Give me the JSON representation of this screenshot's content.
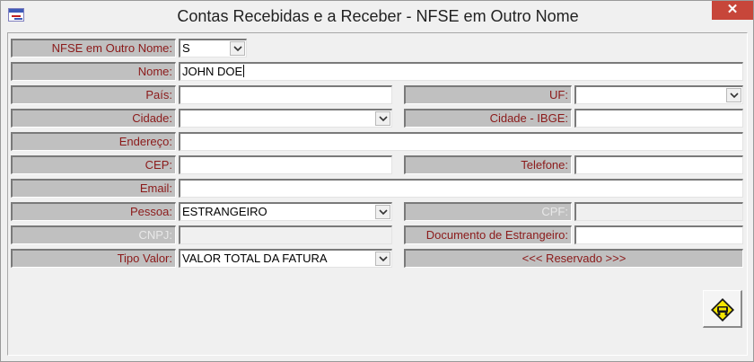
{
  "window": {
    "title": "Contas Recebidas e a Receber - NFSE em Outro Nome",
    "close_glyph": "✕",
    "icon": "form-icon"
  },
  "colors": {
    "label_text": "#8b1a1a",
    "label_bg": "#c0c0c0",
    "close_bg": "#c7463a",
    "sign_yellow": "#f5e600"
  },
  "form": {
    "nfse_label": "NFSE em Outro Nome:",
    "nfse_value": "S",
    "nome_label": "Nome:",
    "nome_value": "JOHN DOE",
    "pais_label": "País:",
    "pais_value": "",
    "uf_label": "UF:",
    "uf_value": "",
    "cidade_label": "Cidade:",
    "cidade_value": "",
    "cidade_ibge_label": "Cidade - IBGE:",
    "cidade_ibge_value": "",
    "endereco_label": "Endereço:",
    "endereco_value": "",
    "cep_label": "CEP:",
    "cep_value": "",
    "telefone_label": "Telefone:",
    "telefone_value": "",
    "email_label": "Email:",
    "email_value": "",
    "pessoa_label": "Pessoa:",
    "pessoa_value": "ESTRANGEIRO",
    "cpf_label": "CPF:",
    "cpf_value": "",
    "cnpj_label": "CNPJ:",
    "cnpj_value": "",
    "documento_label": "Documento de Estrangeiro:",
    "documento_value": "",
    "tipo_valor_label": "Tipo Valor:",
    "tipo_valor_value": "VALOR TOTAL DA FATURA",
    "reservado_label": "<<< Reservado >>>"
  },
  "action_button": {
    "icon": "road-sign-icon"
  }
}
